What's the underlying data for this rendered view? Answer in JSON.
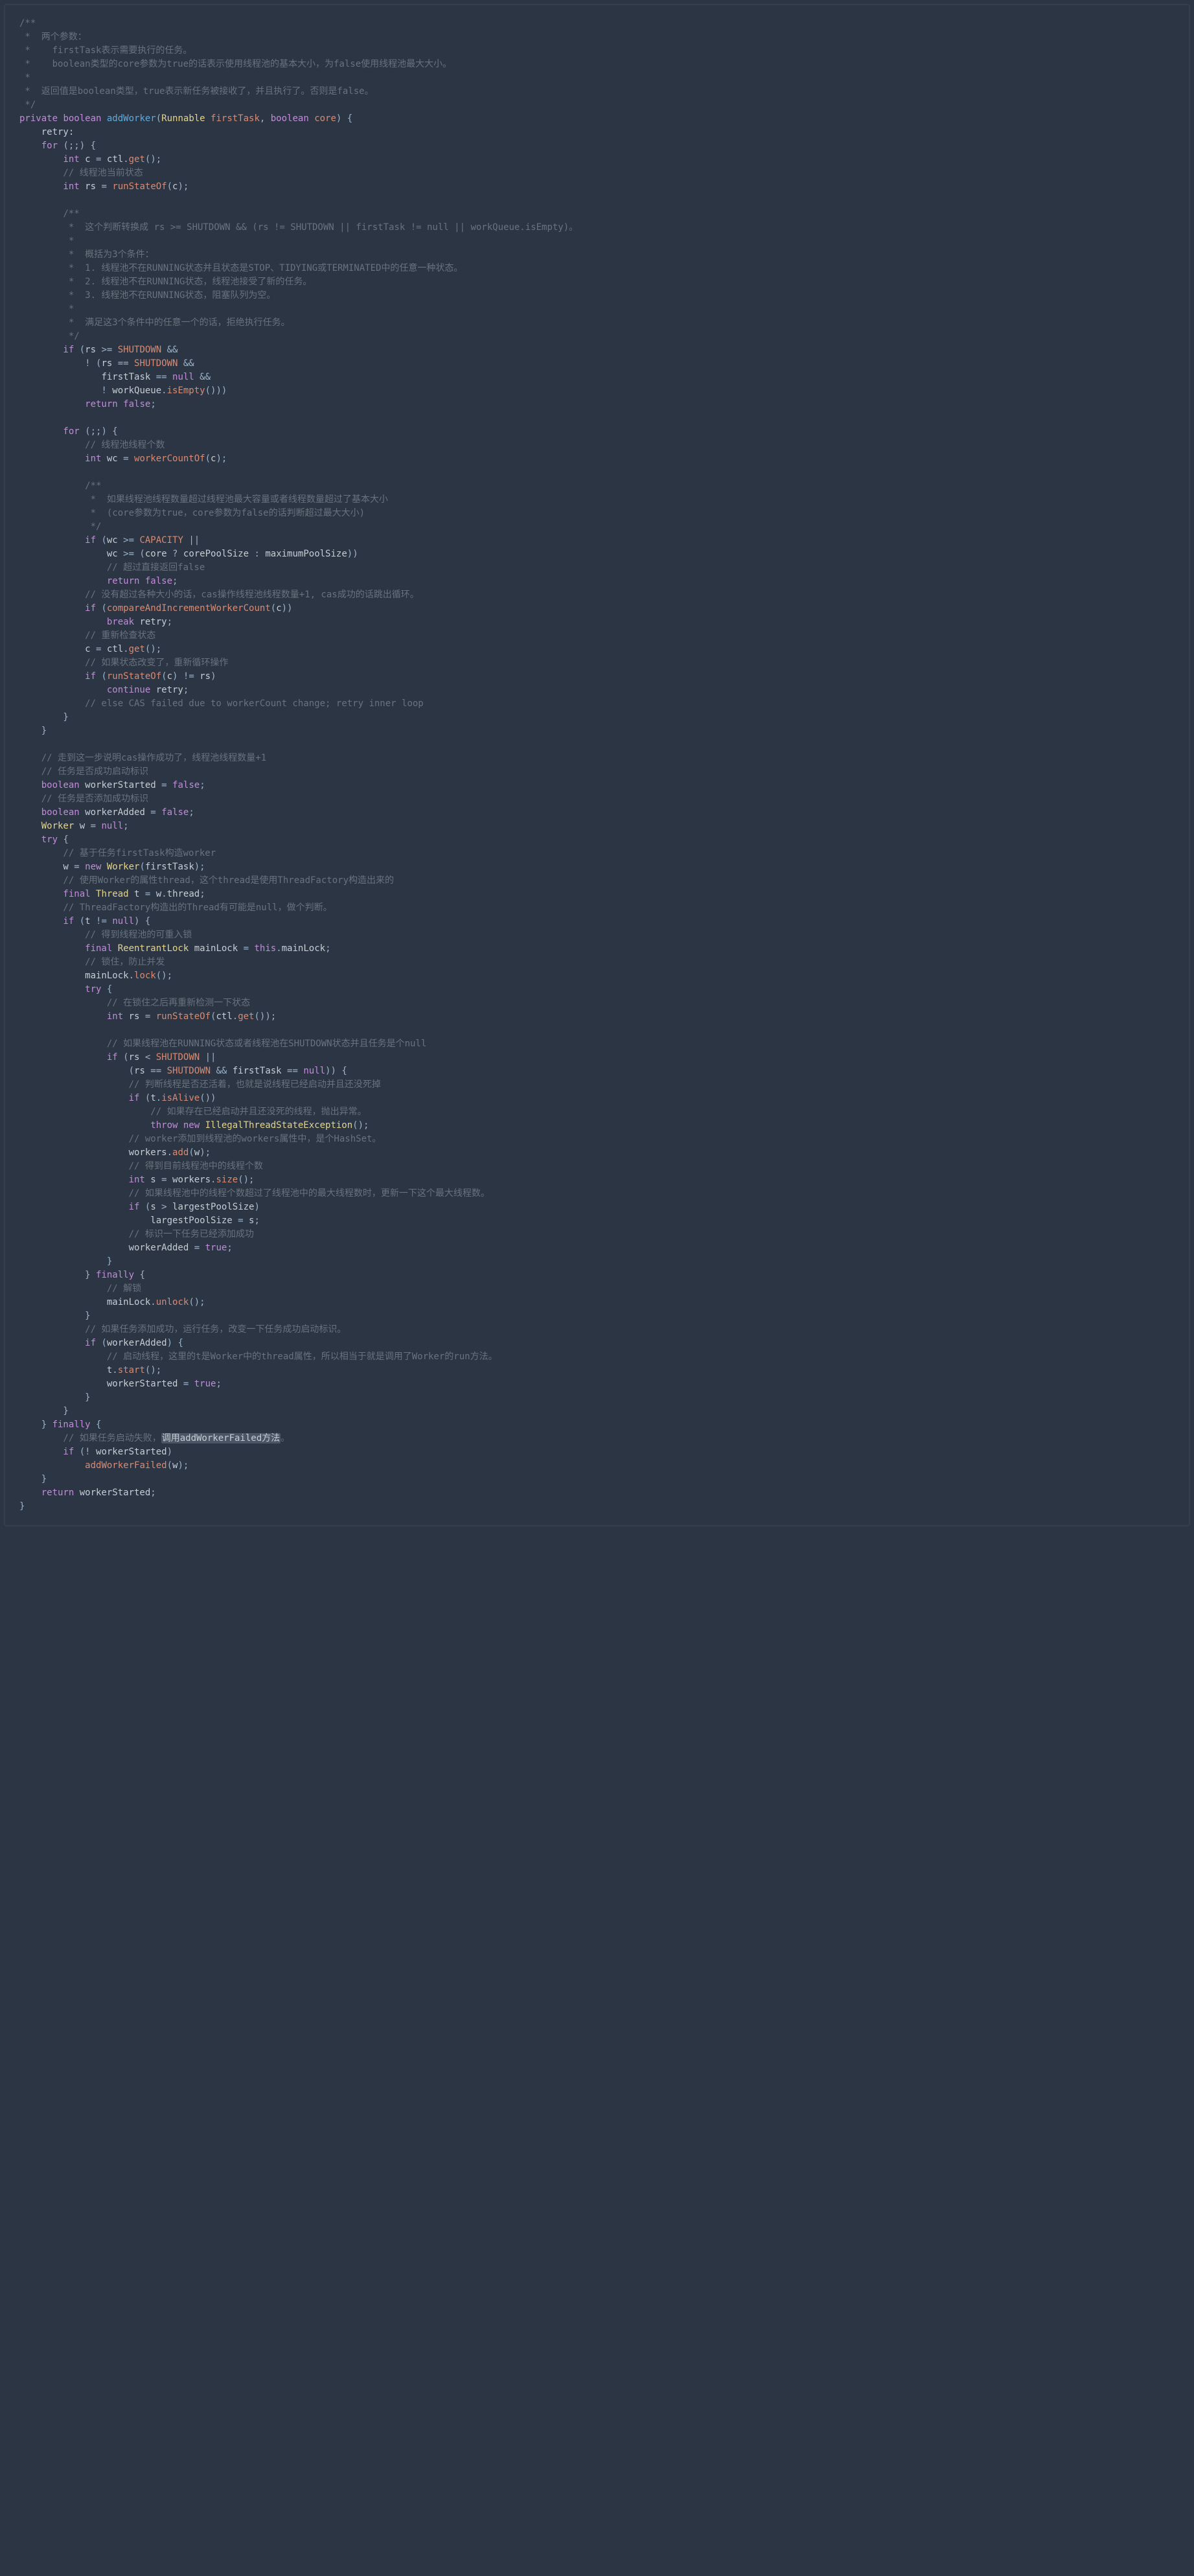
{
  "code": {
    "tokens": [
      {
        "c": "cm",
        "t": "/**\n *  两个参数：\n *    firstTask表示需要执行的任务。\n *    boolean类型的core参数为true的话表示使用线程池的基本大小，为false使用线程池最大大小。\n *\n *  返回值是boolean类型，true表示新任务被接收了，并且执行了。否则是false。\n */\n"
      },
      {
        "c": "kw",
        "t": "private "
      },
      {
        "c": "kw",
        "t": "boolean "
      },
      {
        "c": "mn",
        "t": "addWorker"
      },
      {
        "c": "op",
        "t": "("
      },
      {
        "c": "ty",
        "t": "Runnable "
      },
      {
        "c": "pr",
        "t": "firstTask"
      },
      {
        "c": "op",
        "t": ", "
      },
      {
        "c": "kw",
        "t": "boolean "
      },
      {
        "c": "pr",
        "t": "core"
      },
      {
        "c": "op",
        "t": ") {\n"
      },
      {
        "c": "lb",
        "t": "    retry:\n"
      },
      {
        "c": "kw",
        "t": "    for "
      },
      {
        "c": "op",
        "t": "(;;) {\n"
      },
      {
        "c": "kw",
        "t": "        int "
      },
      {
        "c": "id",
        "t": "c"
      },
      {
        "c": "op",
        "t": " = "
      },
      {
        "c": "id",
        "t": "ctl"
      },
      {
        "c": "op",
        "t": "."
      },
      {
        "c": "cl",
        "t": "get"
      },
      {
        "c": "op",
        "t": "();\n"
      },
      {
        "c": "cm",
        "t": "        // 线程池当前状态\n"
      },
      {
        "c": "kw",
        "t": "        int "
      },
      {
        "c": "id",
        "t": "rs"
      },
      {
        "c": "op",
        "t": " = "
      },
      {
        "c": "cl",
        "t": "runStateOf"
      },
      {
        "c": "op",
        "t": "("
      },
      {
        "c": "id",
        "t": "c"
      },
      {
        "c": "op",
        "t": ");\n\n"
      },
      {
        "c": "cm",
        "t": "        /**\n         *  这个判断转换成 rs >= SHUTDOWN && (rs != SHUTDOWN || firstTask != null || workQueue.isEmpty)。\n         *\n         *  概括为3个条件：\n         *  1. 线程池不在RUNNING状态并且状态是STOP、TIDYING或TERMINATED中的任意一种状态。\n         *  2. 线程池不在RUNNING状态，线程池接受了新的任务。\n         *  3. 线程池不在RUNNING状态，阻塞队列为空。\n         *\n         *  满足这3个条件中的任意一个的话，拒绝执行任务。\n         */\n"
      },
      {
        "c": "kw",
        "t": "        if "
      },
      {
        "c": "op",
        "t": "("
      },
      {
        "c": "id",
        "t": "rs"
      },
      {
        "c": "op",
        "t": " >= "
      },
      {
        "c": "cn",
        "t": "SHUTDOWN"
      },
      {
        "c": "op",
        "t": " &&\n            ! ("
      },
      {
        "c": "id",
        "t": "rs"
      },
      {
        "c": "op",
        "t": " == "
      },
      {
        "c": "cn",
        "t": "SHUTDOWN"
      },
      {
        "c": "op",
        "t": " &&\n               "
      },
      {
        "c": "id",
        "t": "firstTask"
      },
      {
        "c": "op",
        "t": " == "
      },
      {
        "c": "kc",
        "t": "null"
      },
      {
        "c": "op",
        "t": " &&\n               ! "
      },
      {
        "c": "id",
        "t": "workQueue"
      },
      {
        "c": "op",
        "t": "."
      },
      {
        "c": "cl",
        "t": "isEmpty"
      },
      {
        "c": "op",
        "t": "()))\n"
      },
      {
        "c": "kw",
        "t": "            return "
      },
      {
        "c": "kc",
        "t": "false"
      },
      {
        "c": "op",
        "t": ";\n\n"
      },
      {
        "c": "kw",
        "t": "        for "
      },
      {
        "c": "op",
        "t": "(;;) {\n"
      },
      {
        "c": "cm",
        "t": "            // 线程池线程个数\n"
      },
      {
        "c": "kw",
        "t": "            int "
      },
      {
        "c": "id",
        "t": "wc"
      },
      {
        "c": "op",
        "t": " = "
      },
      {
        "c": "cl",
        "t": "workerCountOf"
      },
      {
        "c": "op",
        "t": "("
      },
      {
        "c": "id",
        "t": "c"
      },
      {
        "c": "op",
        "t": ");\n\n"
      },
      {
        "c": "cm",
        "t": "            /**\n             *  如果线程池线程数量超过线程池最大容量或者线程数量超过了基本大小\n             *  (core参数为true，core参数为false的话判断超过最大大小)\n             */\n"
      },
      {
        "c": "kw",
        "t": "            if "
      },
      {
        "c": "op",
        "t": "("
      },
      {
        "c": "id",
        "t": "wc"
      },
      {
        "c": "op",
        "t": " >= "
      },
      {
        "c": "cn",
        "t": "CAPACITY"
      },
      {
        "c": "op",
        "t": " ||\n                "
      },
      {
        "c": "id",
        "t": "wc"
      },
      {
        "c": "op",
        "t": " >= ("
      },
      {
        "c": "id",
        "t": "core"
      },
      {
        "c": "op",
        "t": " ? "
      },
      {
        "c": "id",
        "t": "corePoolSize"
      },
      {
        "c": "op",
        "t": " : "
      },
      {
        "c": "id",
        "t": "maximumPoolSize"
      },
      {
        "c": "op",
        "t": "))\n"
      },
      {
        "c": "cm",
        "t": "                // 超过直接返回false\n"
      },
      {
        "c": "kw",
        "t": "                return "
      },
      {
        "c": "kc",
        "t": "false"
      },
      {
        "c": "op",
        "t": ";\n"
      },
      {
        "c": "cm",
        "t": "            // 没有超过各种大小的话，cas操作线程池线程数量+1, cas成功的话跳出循环。\n"
      },
      {
        "c": "kw",
        "t": "            if "
      },
      {
        "c": "op",
        "t": "("
      },
      {
        "c": "cl",
        "t": "compareAndIncrementWorkerCount"
      },
      {
        "c": "op",
        "t": "("
      },
      {
        "c": "id",
        "t": "c"
      },
      {
        "c": "op",
        "t": "))\n"
      },
      {
        "c": "kw",
        "t": "                break "
      },
      {
        "c": "lb",
        "t": "retry"
      },
      {
        "c": "op",
        "t": ";\n"
      },
      {
        "c": "cm",
        "t": "            // 重新检查状态\n"
      },
      {
        "c": "id",
        "t": "            c"
      },
      {
        "c": "op",
        "t": " = "
      },
      {
        "c": "id",
        "t": "ctl"
      },
      {
        "c": "op",
        "t": "."
      },
      {
        "c": "cl",
        "t": "get"
      },
      {
        "c": "op",
        "t": "();\n"
      },
      {
        "c": "cm",
        "t": "            // 如果状态改变了，重新循环操作\n"
      },
      {
        "c": "kw",
        "t": "            if "
      },
      {
        "c": "op",
        "t": "("
      },
      {
        "c": "cl",
        "t": "runStateOf"
      },
      {
        "c": "op",
        "t": "("
      },
      {
        "c": "id",
        "t": "c"
      },
      {
        "c": "op",
        "t": ") != "
      },
      {
        "c": "id",
        "t": "rs"
      },
      {
        "c": "op",
        "t": ")\n"
      },
      {
        "c": "kw",
        "t": "                continue "
      },
      {
        "c": "lb",
        "t": "retry"
      },
      {
        "c": "op",
        "t": ";\n"
      },
      {
        "c": "cm",
        "t": "            // else CAS failed due to workerCount change; retry inner loop\n"
      },
      {
        "c": "op",
        "t": "        }\n    }\n\n"
      },
      {
        "c": "cm",
        "t": "    // 走到这一步说明cas操作成功了，线程池线程数量+1\n"
      },
      {
        "c": "cm",
        "t": "    // 任务是否成功启动标识\n"
      },
      {
        "c": "kw",
        "t": "    boolean "
      },
      {
        "c": "id",
        "t": "workerStarted"
      },
      {
        "c": "op",
        "t": " = "
      },
      {
        "c": "kc",
        "t": "false"
      },
      {
        "c": "op",
        "t": ";\n"
      },
      {
        "c": "cm",
        "t": "    // 任务是否添加成功标识\n"
      },
      {
        "c": "kw",
        "t": "    boolean "
      },
      {
        "c": "id",
        "t": "workerAdded"
      },
      {
        "c": "op",
        "t": " = "
      },
      {
        "c": "kc",
        "t": "false"
      },
      {
        "c": "op",
        "t": ";\n"
      },
      {
        "c": "ty",
        "t": "    Worker "
      },
      {
        "c": "id",
        "t": "w"
      },
      {
        "c": "op",
        "t": " = "
      },
      {
        "c": "kc",
        "t": "null"
      },
      {
        "c": "op",
        "t": ";\n"
      },
      {
        "c": "kw",
        "t": "    try "
      },
      {
        "c": "op",
        "t": "{\n"
      },
      {
        "c": "cm",
        "t": "        // 基于任务firstTask构造worker\n"
      },
      {
        "c": "id",
        "t": "        w"
      },
      {
        "c": "op",
        "t": " = "
      },
      {
        "c": "kw",
        "t": "new "
      },
      {
        "c": "ty",
        "t": "Worker"
      },
      {
        "c": "op",
        "t": "("
      },
      {
        "c": "id",
        "t": "firstTask"
      },
      {
        "c": "op",
        "t": ");\n"
      },
      {
        "c": "cm",
        "t": "        // 使用Worker的属性thread，这个thread是使用ThreadFactory构造出来的\n"
      },
      {
        "c": "kw",
        "t": "        final "
      },
      {
        "c": "ty",
        "t": "Thread "
      },
      {
        "c": "id",
        "t": "t"
      },
      {
        "c": "op",
        "t": " = "
      },
      {
        "c": "id",
        "t": "w"
      },
      {
        "c": "op",
        "t": "."
      },
      {
        "c": "id",
        "t": "thread"
      },
      {
        "c": "op",
        "t": ";\n"
      },
      {
        "c": "cm",
        "t": "        // ThreadFactory构造出的Thread有可能是null，做个判断。\n"
      },
      {
        "c": "kw",
        "t": "        if "
      },
      {
        "c": "op",
        "t": "("
      },
      {
        "c": "id",
        "t": "t"
      },
      {
        "c": "op",
        "t": " != "
      },
      {
        "c": "kc",
        "t": "null"
      },
      {
        "c": "op",
        "t": ") {\n"
      },
      {
        "c": "cm",
        "t": "            // 得到线程池的可重入锁\n"
      },
      {
        "c": "kw",
        "t": "            final "
      },
      {
        "c": "ty",
        "t": "ReentrantLock "
      },
      {
        "c": "id",
        "t": "mainLock"
      },
      {
        "c": "op",
        "t": " = "
      },
      {
        "c": "kc",
        "t": "this"
      },
      {
        "c": "op",
        "t": "."
      },
      {
        "c": "id",
        "t": "mainLock"
      },
      {
        "c": "op",
        "t": ";\n"
      },
      {
        "c": "cm",
        "t": "            // 锁住，防止并发\n"
      },
      {
        "c": "id",
        "t": "            mainLock"
      },
      {
        "c": "op",
        "t": "."
      },
      {
        "c": "cl",
        "t": "lock"
      },
      {
        "c": "op",
        "t": "();\n"
      },
      {
        "c": "kw",
        "t": "            try "
      },
      {
        "c": "op",
        "t": "{\n"
      },
      {
        "c": "cm",
        "t": "                // 在锁住之后再重新检测一下状态\n"
      },
      {
        "c": "kw",
        "t": "                int "
      },
      {
        "c": "id",
        "t": "rs"
      },
      {
        "c": "op",
        "t": " = "
      },
      {
        "c": "cl",
        "t": "runStateOf"
      },
      {
        "c": "op",
        "t": "("
      },
      {
        "c": "id",
        "t": "ctl"
      },
      {
        "c": "op",
        "t": "."
      },
      {
        "c": "cl",
        "t": "get"
      },
      {
        "c": "op",
        "t": "());\n\n"
      },
      {
        "c": "cm",
        "t": "                // 如果线程池在RUNNING状态或者线程池在SHUTDOWN状态并且任务是个null\n"
      },
      {
        "c": "kw",
        "t": "                if "
      },
      {
        "c": "op",
        "t": "("
      },
      {
        "c": "id",
        "t": "rs"
      },
      {
        "c": "op",
        "t": " < "
      },
      {
        "c": "cn",
        "t": "SHUTDOWN"
      },
      {
        "c": "op",
        "t": " ||\n                    ("
      },
      {
        "c": "id",
        "t": "rs"
      },
      {
        "c": "op",
        "t": " == "
      },
      {
        "c": "cn",
        "t": "SHUTDOWN"
      },
      {
        "c": "op",
        "t": " && "
      },
      {
        "c": "id",
        "t": "firstTask"
      },
      {
        "c": "op",
        "t": " == "
      },
      {
        "c": "kc",
        "t": "null"
      },
      {
        "c": "op",
        "t": ")) {\n"
      },
      {
        "c": "cm",
        "t": "                    // 判断线程是否还活着，也就是说线程已经启动并且还没死掉\n"
      },
      {
        "c": "kw",
        "t": "                    if "
      },
      {
        "c": "op",
        "t": "("
      },
      {
        "c": "id",
        "t": "t"
      },
      {
        "c": "op",
        "t": "."
      },
      {
        "c": "cl",
        "t": "isAlive"
      },
      {
        "c": "op",
        "t": "())\n"
      },
      {
        "c": "cm",
        "t": "                        // 如果存在已经启动并且还没死的线程，抛出异常。\n"
      },
      {
        "c": "kw",
        "t": "                        throw new "
      },
      {
        "c": "ty",
        "t": "IllegalThreadStateException"
      },
      {
        "c": "op",
        "t": "();\n"
      },
      {
        "c": "cm",
        "t": "                    // worker添加到线程池的workers属性中，是个HashSet。\n"
      },
      {
        "c": "id",
        "t": "                    workers"
      },
      {
        "c": "op",
        "t": "."
      },
      {
        "c": "cl",
        "t": "add"
      },
      {
        "c": "op",
        "t": "("
      },
      {
        "c": "id",
        "t": "w"
      },
      {
        "c": "op",
        "t": ");\n"
      },
      {
        "c": "cm",
        "t": "                    // 得到目前线程池中的线程个数\n"
      },
      {
        "c": "kw",
        "t": "                    int "
      },
      {
        "c": "id",
        "t": "s"
      },
      {
        "c": "op",
        "t": " = "
      },
      {
        "c": "id",
        "t": "workers"
      },
      {
        "c": "op",
        "t": "."
      },
      {
        "c": "cl",
        "t": "size"
      },
      {
        "c": "op",
        "t": "();\n"
      },
      {
        "c": "cm",
        "t": "                    // 如果线程池中的线程个数超过了线程池中的最大线程数时，更新一下这个最大线程数。\n"
      },
      {
        "c": "kw",
        "t": "                    if "
      },
      {
        "c": "op",
        "t": "("
      },
      {
        "c": "id",
        "t": "s"
      },
      {
        "c": "op",
        "t": " > "
      },
      {
        "c": "id",
        "t": "largestPoolSize"
      },
      {
        "c": "op",
        "t": ")\n                        "
      },
      {
        "c": "id",
        "t": "largestPoolSize"
      },
      {
        "c": "op",
        "t": " = "
      },
      {
        "c": "id",
        "t": "s"
      },
      {
        "c": "op",
        "t": ";\n"
      },
      {
        "c": "cm",
        "t": "                    // 标识一下任务已经添加成功\n"
      },
      {
        "c": "id",
        "t": "                    workerAdded"
      },
      {
        "c": "op",
        "t": " = "
      },
      {
        "c": "kc",
        "t": "true"
      },
      {
        "c": "op",
        "t": ";\n                }\n"
      },
      {
        "c": "op",
        "t": "            } "
      },
      {
        "c": "kw",
        "t": "finally "
      },
      {
        "c": "op",
        "t": "{\n"
      },
      {
        "c": "cm",
        "t": "                // 解锁\n"
      },
      {
        "c": "id",
        "t": "                mainLock"
      },
      {
        "c": "op",
        "t": "."
      },
      {
        "c": "cl",
        "t": "unlock"
      },
      {
        "c": "op",
        "t": "();\n            }\n"
      },
      {
        "c": "cm",
        "t": "            // 如果任务添加成功，运行任务，改变一下任务成功启动标识。\n"
      },
      {
        "c": "kw",
        "t": "            if "
      },
      {
        "c": "op",
        "t": "("
      },
      {
        "c": "id",
        "t": "workerAdded"
      },
      {
        "c": "op",
        "t": ") {\n"
      },
      {
        "c": "cm",
        "t": "                // 启动线程，这里的t是Worker中的thread属性，所以相当于就是调用了Worker的run方法。\n"
      },
      {
        "c": "id",
        "t": "                t"
      },
      {
        "c": "op",
        "t": "."
      },
      {
        "c": "cl",
        "t": "start"
      },
      {
        "c": "op",
        "t": "();\n                "
      },
      {
        "c": "id",
        "t": "workerStarted"
      },
      {
        "c": "op",
        "t": " = "
      },
      {
        "c": "kc",
        "t": "true"
      },
      {
        "c": "op",
        "t": ";\n            }\n        }\n"
      },
      {
        "c": "op",
        "t": "    } "
      },
      {
        "c": "kw",
        "t": "finally "
      },
      {
        "c": "op",
        "t": "{\n"
      },
      {
        "c": "cm",
        "t": "        // 如果任务启动失败，"
      },
      {
        "c": "hl",
        "t": "调用addWorkerFailed方法"
      },
      {
        "c": "cm",
        "t": "。\n"
      },
      {
        "c": "kw",
        "t": "        if "
      },
      {
        "c": "op",
        "t": "(! "
      },
      {
        "c": "id",
        "t": "workerStarted"
      },
      {
        "c": "op",
        "t": ")\n            "
      },
      {
        "c": "cl",
        "t": "addWorkerFailed"
      },
      {
        "c": "op",
        "t": "("
      },
      {
        "c": "id",
        "t": "w"
      },
      {
        "c": "op",
        "t": ");\n    }\n"
      },
      {
        "c": "kw",
        "t": "    return "
      },
      {
        "c": "id",
        "t": "workerStarted"
      },
      {
        "c": "op",
        "t": ";\n}"
      }
    ]
  }
}
